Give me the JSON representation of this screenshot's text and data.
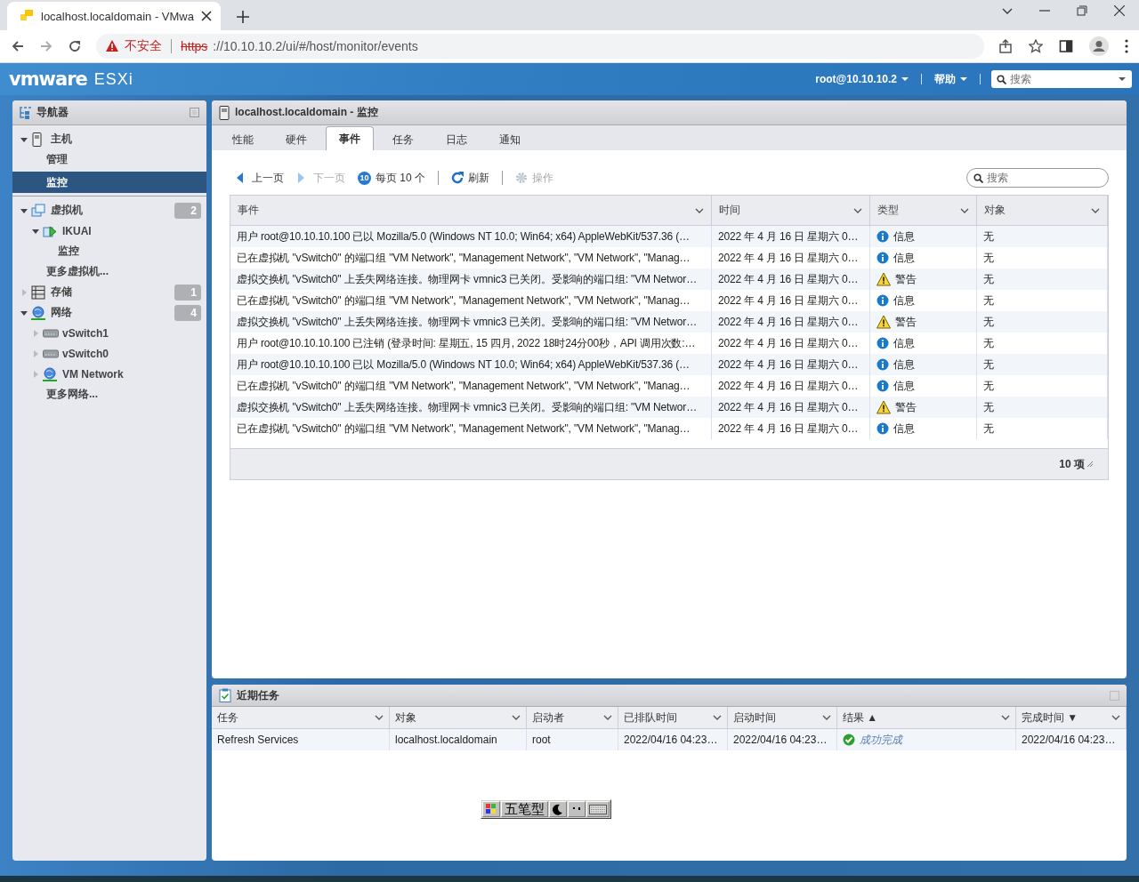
{
  "browser": {
    "tab_title": "localhost.localdomain - VMwa",
    "security_label": "不安全",
    "url_scheme": "https",
    "url_rest": "://10.10.10.2/ui/#/host/monitor/events"
  },
  "header": {
    "logo": "vmware",
    "product": "ESXi",
    "user": "root@10.10.10.2",
    "help": "帮助",
    "search": {
      "placeholder": "搜索"
    }
  },
  "navigator": {
    "title": "导航器",
    "items": [
      {
        "label": "主机",
        "kind": "host",
        "expanded": true,
        "selected": false,
        "children": [
          {
            "label": "管理",
            "selected": false
          },
          {
            "label": "监控",
            "selected": true
          }
        ]
      },
      {
        "label": "虚拟机",
        "kind": "vm",
        "count": "2",
        "expanded": true,
        "selected": false,
        "children": [
          {
            "label": "IKUAI",
            "kind": "vm-on",
            "expanded": true,
            "selected": false,
            "children": [
              {
                "label": "监控",
                "selected": false
              }
            ]
          },
          {
            "label": "更多虚拟机...",
            "selected": false
          }
        ]
      },
      {
        "label": "存储",
        "kind": "storage",
        "count": "1",
        "expanded": false,
        "selected": false
      },
      {
        "label": "网络",
        "kind": "network",
        "count": "4",
        "expanded": true,
        "selected": false,
        "children": [
          {
            "label": "vSwitch1",
            "kind": "switch",
            "expanded": false,
            "selected": false
          },
          {
            "label": "vSwitch0",
            "kind": "switch",
            "expanded": false,
            "selected": false
          },
          {
            "label": "VM Network",
            "kind": "network",
            "expanded": false,
            "selected": false
          },
          {
            "label": "更多网络...",
            "selected": false
          }
        ]
      }
    ]
  },
  "monitor": {
    "title": "localhost.localdomain - 监控",
    "tabs": [
      {
        "label": "性能",
        "selected": false
      },
      {
        "label": "硬件",
        "selected": false
      },
      {
        "label": "事件",
        "selected": true
      },
      {
        "label": "任务",
        "selected": false
      },
      {
        "label": "日志",
        "selected": false
      },
      {
        "label": "通知",
        "selected": false
      }
    ],
    "toolbar": [
      {
        "kind": "prev",
        "label": "上一页",
        "disabled": false
      },
      {
        "kind": "next",
        "label": "下一页",
        "disabled": true
      },
      {
        "kind": "page-size",
        "badge": "10",
        "label": "每页 10 个",
        "disabled": false
      },
      {
        "kind": "refresh",
        "label": "刷新",
        "disabled": false
      },
      {
        "kind": "actions",
        "label": "操作",
        "disabled": true
      }
    ],
    "search": {
      "placeholder": "搜索"
    },
    "table": {
      "columns": [
        "事件",
        "时间",
        "类型",
        "对象"
      ],
      "rows": [
        {
          "event": "用户 root@10.10.10.100 已以 Mozilla/5.0 (Windows NT 10.0; Win64; x64) AppleWebKit/537.36 (…",
          "time": "2022 年 4 月 16 日 星期六 0…",
          "type": {
            "kind": "info",
            "label": "信息"
          },
          "object": "无"
        },
        {
          "event": "已在虚拟机 \"vSwitch0\" 的端口组 \"VM Network\", \"Management Network\", \"VM Network\", \"Manag…",
          "time": "2022 年 4 月 16 日 星期六 0…",
          "type": {
            "kind": "info",
            "label": "信息"
          },
          "object": "无"
        },
        {
          "event": "虚拟交换机 \"vSwitch0\" 上丢失网络连接。物理网卡 vmnic3 已关闭。受影响的端口组: \"VM Networ…",
          "time": "2022 年 4 月 16 日 星期六 0…",
          "type": {
            "kind": "warning",
            "label": "警告"
          },
          "object": "无"
        },
        {
          "event": "已在虚拟机 \"vSwitch0\" 的端口组 \"VM Network\", \"Management Network\", \"VM Network\", \"Manag…",
          "time": "2022 年 4 月 16 日 星期六 0…",
          "type": {
            "kind": "info",
            "label": "信息"
          },
          "object": "无"
        },
        {
          "event": "虚拟交换机 \"vSwitch0\" 上丢失网络连接。物理网卡 vmnic3 已关闭。受影响的端口组: \"VM Networ…",
          "time": "2022 年 4 月 16 日 星期六 0…",
          "type": {
            "kind": "warning",
            "label": "警告"
          },
          "object": "无"
        },
        {
          "event": "用户 root@10.10.10.100 已注销 (登录时间: 星期五, 15 四月, 2022 18时24分00秒，API 调用次数:…",
          "time": "2022 年 4 月 16 日 星期六 0…",
          "type": {
            "kind": "info",
            "label": "信息"
          },
          "object": "无"
        },
        {
          "event": "用户 root@10.10.10.100 已以 Mozilla/5.0 (Windows NT 10.0; Win64; x64) AppleWebKit/537.36 (…",
          "time": "2022 年 4 月 16 日 星期六 0…",
          "type": {
            "kind": "info",
            "label": "信息"
          },
          "object": "无"
        },
        {
          "event": "已在虚拟机 \"vSwitch0\" 的端口组 \"VM Network\", \"Management Network\", \"VM Network\", \"Manag…",
          "time": "2022 年 4 月 16 日 星期六 0…",
          "type": {
            "kind": "info",
            "label": "信息"
          },
          "object": "无"
        },
        {
          "event": "虚拟交换机 \"vSwitch0\" 上丢失网络连接。物理网卡 vmnic3 已关闭。受影响的端口组: \"VM Networ…",
          "time": "2022 年 4 月 16 日 星期六 0…",
          "type": {
            "kind": "warning",
            "label": "警告"
          },
          "object": "无"
        },
        {
          "event": "已在虚拟机 \"vSwitch0\" 的端口组 \"VM Network\", \"Management Network\", \"VM Network\", \"Manag…",
          "time": "2022 年 4 月 16 日 星期六 0…",
          "type": {
            "kind": "info",
            "label": "信息"
          },
          "object": "无"
        }
      ],
      "footer": "10 项"
    }
  },
  "recent_tasks": {
    "title": "近期任务",
    "columns": [
      {
        "label": "任务"
      },
      {
        "label": "对象"
      },
      {
        "label": "启动者"
      },
      {
        "label": "已排队时间"
      },
      {
        "label": "启动时间"
      },
      {
        "label": "结果",
        "sort_mark": "▲"
      },
      {
        "label": "完成时间",
        "sort_mark": "▼"
      }
    ],
    "rows": [
      {
        "task": "Refresh Services",
        "object": "localhost.localdomain",
        "initiator": "root",
        "queued": "2022/04/16 04:23…",
        "started": "2022/04/16 04:23…",
        "result": {
          "kind": "success",
          "label": "成功完成"
        },
        "completed": "2022/04/16 04:23…"
      }
    ]
  },
  "ime": {
    "mode": "五笔型"
  }
}
